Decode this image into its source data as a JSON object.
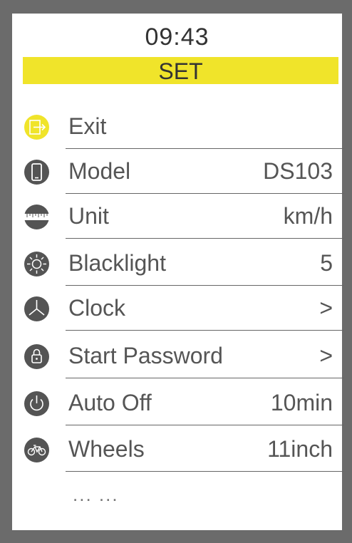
{
  "header": {
    "time": "09:43",
    "title": "SET"
  },
  "menu": [
    {
      "label": "Exit",
      "value": "",
      "icon": "exit-icon"
    },
    {
      "label": "Model",
      "value": "DS103",
      "icon": "phone-icon"
    },
    {
      "label": "Unit",
      "value": "km/h",
      "icon": "ruler-icon"
    },
    {
      "label": "Blacklight",
      "value": "5",
      "icon": "sun-icon"
    },
    {
      "label": "Clock",
      "value": ">",
      "icon": "clock-icon"
    },
    {
      "label": "Start Password",
      "value": ">",
      "icon": "lock-icon"
    },
    {
      "label": "Auto Off",
      "value": "10min",
      "icon": "power-icon"
    },
    {
      "label": "Wheels",
      "value": "11inch",
      "icon": "bicycle-icon"
    }
  ],
  "more_text": "... ...",
  "colors": {
    "highlight": "#f0e42a",
    "icon_bg": "#545454",
    "frame": "#6b6b6b"
  }
}
